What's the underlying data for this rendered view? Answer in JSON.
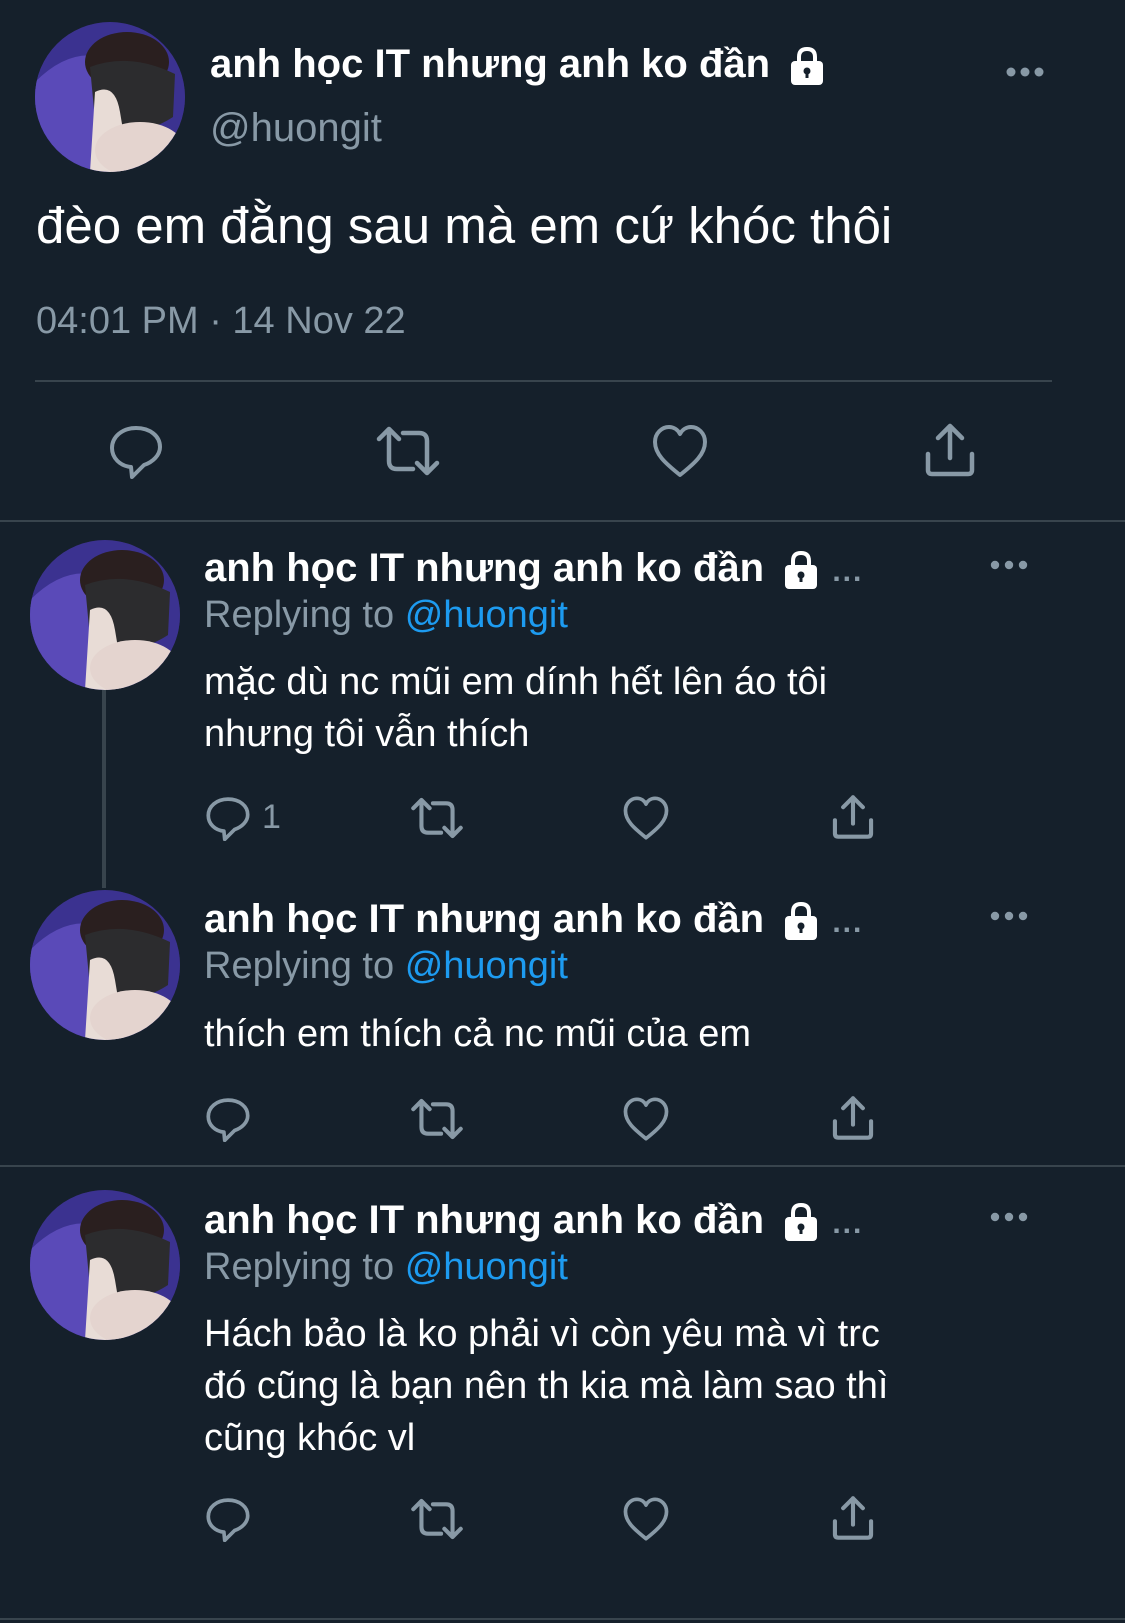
{
  "main_tweet": {
    "display_name": "anh học IT nhưng anh ko đần",
    "handle": "@huongit",
    "text": "đèo em đằng sau mà em cứ khóc thôi",
    "timestamp": "04:01 PM · 14 Nov 22",
    "more_label": "•••",
    "actions": [
      "reply-icon",
      "retweet-icon",
      "like-icon",
      "share-icon"
    ]
  },
  "replies": [
    {
      "display_name": "anh học IT nhưng anh ko đần",
      "truncation": "...",
      "replying_label": "Replying to",
      "replying_handle": "@huongit",
      "text_lines": [
        "mặc dù nc mũi em dính hết lên áo tôi",
        "nhưng tôi vẫn thích"
      ],
      "reply_count": "1",
      "more_label": "•••"
    },
    {
      "display_name": "anh học IT nhưng anh ko đần",
      "truncation": "...",
      "replying_label": "Replying to",
      "replying_handle": "@huongit",
      "text_lines": [
        "thích em thích cả nc mũi của em"
      ],
      "reply_count": "",
      "more_label": "•••"
    },
    {
      "display_name": "anh học IT nhưng anh ko đần",
      "truncation": "...",
      "replying_label": "Replying to",
      "replying_handle": "@huongit",
      "text_lines": [
        "Hách bảo là ko phải vì còn yêu mà vì trc",
        "đó cũng là bạn nên th kia mà làm sao thì",
        "cũng khóc vl"
      ],
      "reply_count": "",
      "more_label": "•••"
    }
  ],
  "colors": {
    "background": "#15202b",
    "secondary_text": "#8899a6",
    "mention": "#1d9bf0",
    "divider": "#38444d"
  }
}
